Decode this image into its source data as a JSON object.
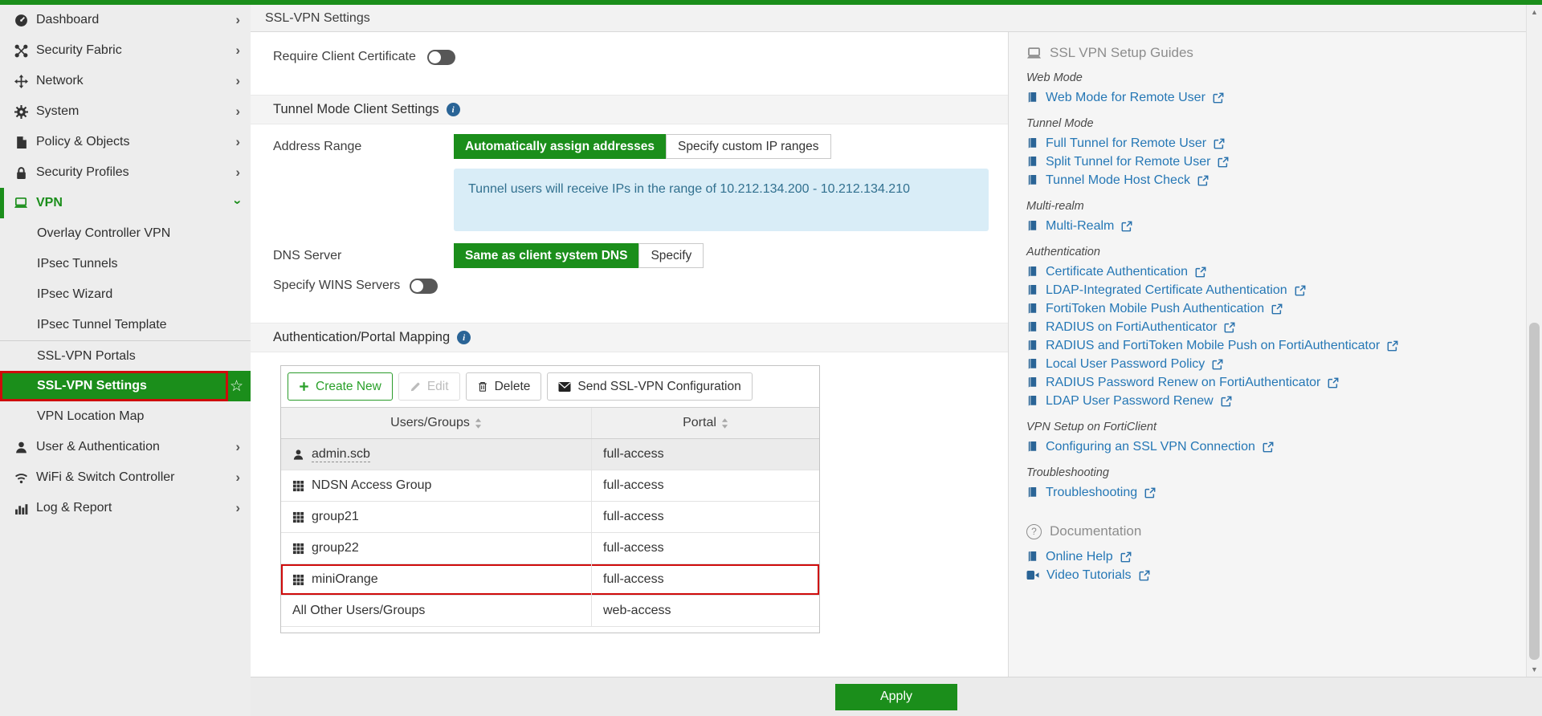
{
  "top_tab": {
    "title": "SSL-VPN Settings"
  },
  "sidebar": {
    "items": [
      {
        "label": "Dashboard"
      },
      {
        "label": "Security Fabric"
      },
      {
        "label": "Network"
      },
      {
        "label": "System"
      },
      {
        "label": "Policy & Objects"
      },
      {
        "label": "Security Profiles"
      },
      {
        "label": "VPN"
      },
      {
        "label": "User & Authentication"
      },
      {
        "label": "WiFi & Switch Controller"
      },
      {
        "label": "Log & Report"
      }
    ],
    "vpn_submenu": [
      "Overlay Controller VPN",
      "IPsec Tunnels",
      "IPsec Wizard",
      "IPsec Tunnel Template",
      "SSL-VPN Portals",
      "SSL-VPN Settings",
      "VPN Location Map"
    ],
    "selected_item": "SSL-VPN Settings"
  },
  "settings": {
    "require_client_certificate": {
      "label": "Require Client Certificate",
      "state": "off"
    },
    "tunnel_section_title": "Tunnel Mode Client Settings",
    "address_range": {
      "label": "Address Range",
      "options": [
        "Automatically assign addresses",
        "Specify custom IP ranges"
      ],
      "selected": "Automatically assign addresses"
    },
    "address_info": "Tunnel users will receive IPs in the range of 10.212.134.200 - 10.212.134.210",
    "dns_server": {
      "label": "DNS Server",
      "options": [
        "Same as client system DNS",
        "Specify"
      ],
      "selected": "Same as client system DNS"
    },
    "wins": {
      "label": "Specify WINS Servers",
      "state": "off"
    },
    "portal_section_title": "Authentication/Portal Mapping"
  },
  "toolbar": {
    "create_label": "Create New",
    "edit_label": "Edit",
    "delete_label": "Delete",
    "send_label": "Send SSL-VPN Configuration"
  },
  "table": {
    "columns": [
      "Users/Groups",
      "Portal"
    ],
    "rows": [
      {
        "name": "admin.scb",
        "portal": "full-access",
        "type": "user",
        "shaded": true
      },
      {
        "name": "NDSN Access Group",
        "portal": "full-access",
        "type": "group"
      },
      {
        "name": "group21",
        "portal": "full-access",
        "type": "group"
      },
      {
        "name": "group22",
        "portal": "full-access",
        "type": "group"
      },
      {
        "name": "miniOrange",
        "portal": "full-access",
        "type": "group",
        "highlighted": true
      },
      {
        "name": "All Other Users/Groups",
        "portal": "web-access",
        "type": "none"
      }
    ]
  },
  "footer": {
    "apply_label": "Apply"
  },
  "guides": {
    "title": "SSL VPN Setup Guides",
    "sections": [
      {
        "heading": "Web Mode",
        "links": [
          "Web Mode for Remote User"
        ]
      },
      {
        "heading": "Tunnel Mode",
        "links": [
          "Full Tunnel for Remote User",
          "Split Tunnel for Remote User",
          "Tunnel Mode Host Check"
        ]
      },
      {
        "heading": "Multi-realm",
        "links": [
          "Multi-Realm"
        ]
      },
      {
        "heading": "Authentication",
        "links": [
          "Certificate Authentication",
          "LDAP-Integrated Certificate Authentication",
          "FortiToken Mobile Push Authentication",
          "RADIUS on FortiAuthenticator",
          "RADIUS and FortiToken Mobile Push on FortiAuthenticator",
          "Local User Password Policy",
          "RADIUS Password Renew on FortiAuthenticator",
          "LDAP User Password Renew"
        ]
      },
      {
        "heading": "VPN Setup on FortiClient",
        "links": [
          "Configuring an SSL VPN Connection"
        ]
      },
      {
        "heading": "Troubleshooting",
        "links": [
          "Troubleshooting"
        ]
      }
    ],
    "documentation": {
      "title": "Documentation",
      "links": [
        "Online Help",
        "Video Tutorials"
      ]
    }
  },
  "glyphs": {
    "chevron": "›",
    "star": "☆",
    "info": "i",
    "question": "?",
    "plus": "+",
    "arrow_up": "▲",
    "arrow_down": "▼"
  },
  "colors": {
    "accent_green": "#1b8e1b",
    "create_green": "#2aa02a",
    "alert_red": "#cf0b0b",
    "link_blue": "#2577b5",
    "info_box_bg": "#d9edf7",
    "info_box_text": "#31708f"
  }
}
